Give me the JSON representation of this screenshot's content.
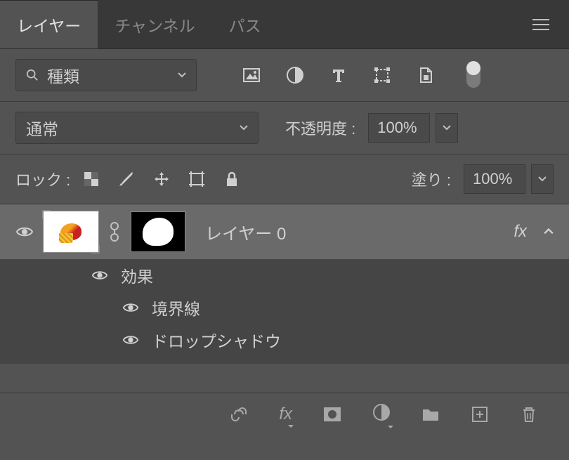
{
  "tabs": {
    "layers": "レイヤー",
    "channels": "チャンネル",
    "paths": "パス"
  },
  "filter": {
    "kind": "種類"
  },
  "blend": {
    "mode": "通常",
    "opacity_label": "不透明度 :",
    "opacity_value": "100%"
  },
  "lock": {
    "label": "ロック :",
    "fill_label": "塗り :",
    "fill_value": "100%"
  },
  "layer": {
    "name": "レイヤー 0",
    "fx": "fx"
  },
  "effects": {
    "heading": "効果",
    "stroke": "境界線",
    "dropshadow": "ドロップシャドウ"
  }
}
